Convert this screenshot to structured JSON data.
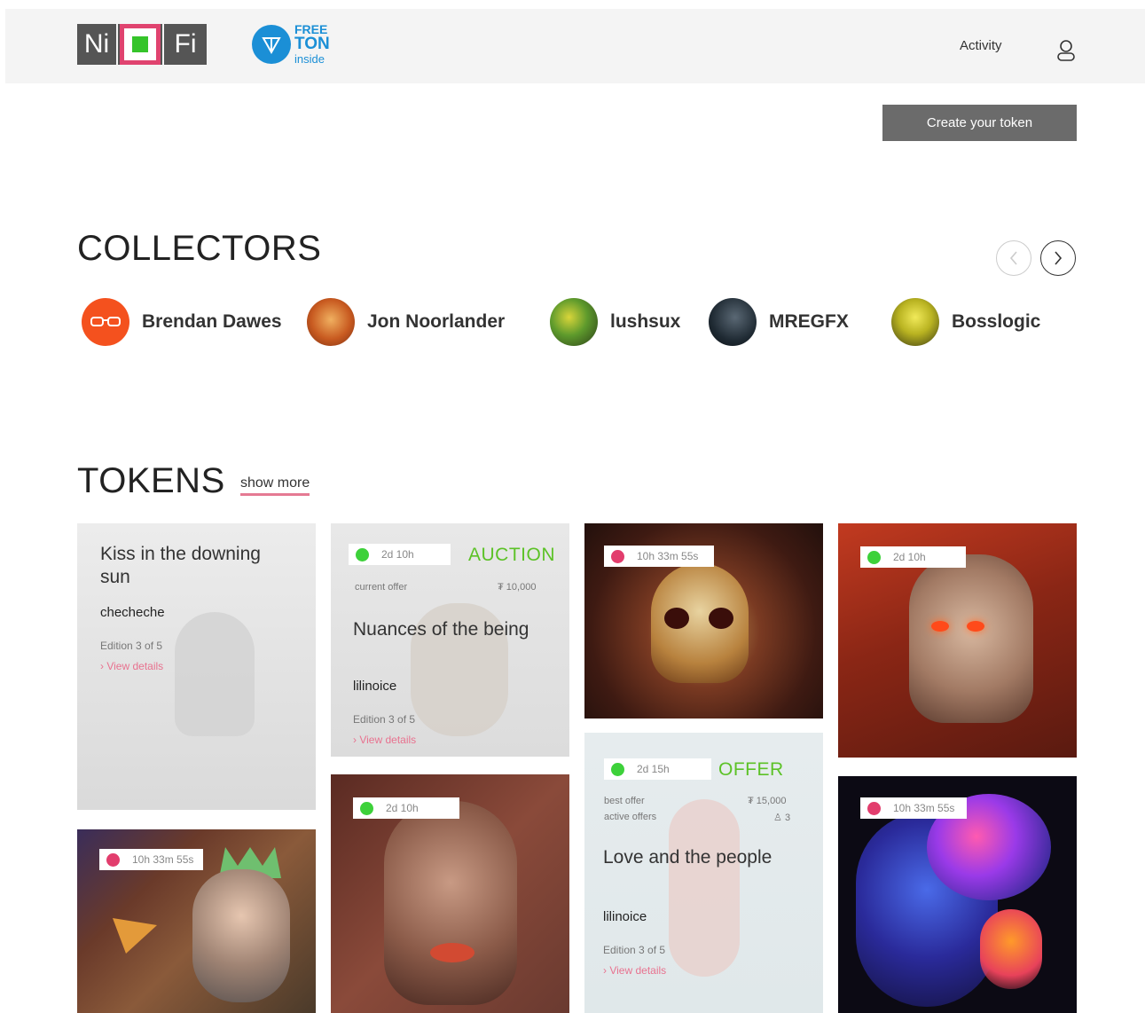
{
  "header": {
    "logo": {
      "left": "Ni",
      "right": "Fi"
    },
    "badge": {
      "line1": "FREE",
      "line2": "TON",
      "line3": "inside"
    },
    "activity_label": "Activity",
    "create_button": "Create your token"
  },
  "collectors": {
    "title": "COLLECTORS",
    "items": [
      {
        "name": "Brendan Dawes",
        "icon": "glasses-avatar",
        "color": "#f4511e"
      },
      {
        "name": "Jon Noorlander",
        "icon": "face-avatar",
        "color": "#d6732e"
      },
      {
        "name": "lushsux",
        "icon": "graffiti-avatar",
        "color": "#4f8a2f"
      },
      {
        "name": "MREGFX",
        "icon": "dark-avatar",
        "color": "#1f2a33"
      },
      {
        "name": "Bosslogic",
        "icon": "yellow-face-avatar",
        "color": "#b9b321"
      }
    ]
  },
  "tokens": {
    "title": "TOKENS",
    "show_more": "show more",
    "cards": [
      {
        "title": "Kiss in the downing sun",
        "author": "checheche",
        "edition": "Edition 3 of 5",
        "link": "View details"
      },
      {
        "timer": "2d 10h",
        "kind": "AUCTION",
        "offer_label": "current offer",
        "offer_value": "10,000",
        "title": "Nuances of the being",
        "author": "lilinoice",
        "edition": "Edition 3 of 5",
        "link": "View details"
      },
      {
        "timer": "10h 33m 55s",
        "image": "golden-skull"
      },
      {
        "timer": "2d 10h",
        "image": "laser-eyes-portrait"
      },
      {
        "timer": "10h 33m 55s",
        "image": "crowned-figure"
      },
      {
        "timer": "2d 10h",
        "image": "painted-face"
      },
      {
        "timer": "2d 15h",
        "kind": "OFFER",
        "offer_label": "best offer",
        "offer_value": "15,000",
        "active_label": "active offers",
        "active_value": "3",
        "title": "Love and the people",
        "author": "lilinoice",
        "edition": "Edition 3 of 5",
        "link": "View details"
      },
      {
        "timer": "10h 33m 55s",
        "image": "colorful-head"
      }
    ]
  },
  "colors": {
    "accent": "#e0436f",
    "brand_green": "#35c42a",
    "ton_blue": "#1b8fd6",
    "live_green": "#3dd13a",
    "ending_red": "#e23d6d",
    "offer_green": "#5cc227"
  }
}
